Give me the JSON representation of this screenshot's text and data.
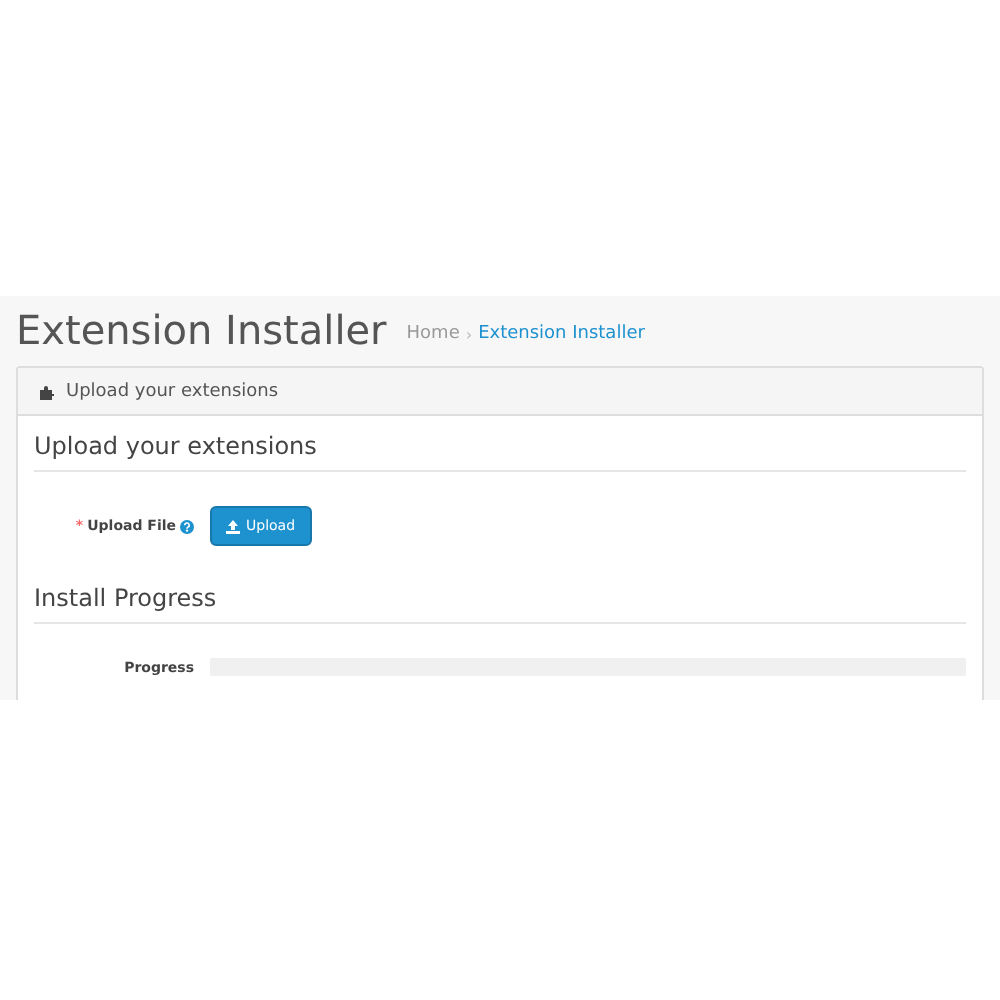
{
  "page_header": {
    "title": "Extension Installer",
    "breadcrumb_separator": "›",
    "breadcrumb": [
      {
        "label": "Home",
        "current": false
      },
      {
        "label": "Extension Installer",
        "current": true
      }
    ]
  },
  "panel": {
    "heading": "Upload your extensions",
    "sections": [
      {
        "title": "Upload your extensions",
        "rows": [
          {
            "kind": "upload",
            "label": "Upload File",
            "required_mark": "*",
            "button": "Upload"
          }
        ]
      },
      {
        "title": "Install Progress",
        "rows": [
          {
            "kind": "progress",
            "label": "Progress",
            "level": 0
          }
        ]
      }
    ]
  }
}
